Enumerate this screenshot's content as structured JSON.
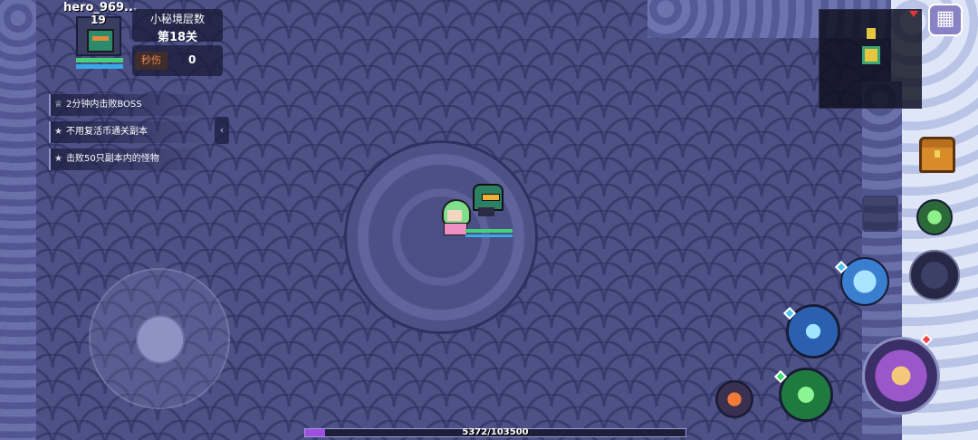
{
  "player": {
    "name": "hero_969...",
    "level": "19",
    "hp_fraction": 1.0,
    "mp_fraction": 1.0
  },
  "dungeon": {
    "floor_label": "小秘境层数",
    "floor_value": "第18关"
  },
  "dps": {
    "label": "秒伤",
    "value": "0"
  },
  "quests": [
    {
      "text": "2分钟内击败BOSS",
      "icon": "crown-icon"
    },
    {
      "text": "不用复活币通关副本",
      "icon": "star-icon"
    },
    {
      "text": "击败50只副本内的怪物",
      "icon": "star-icon"
    }
  ],
  "quest_toggle_icon": "‹",
  "menu_icon": "▦",
  "experience": {
    "text": "5372/103500",
    "fraction": 0.052
  },
  "colors": {
    "hp": "#46d17a",
    "mp": "#3aa7e8",
    "xp": "#9f4ee0",
    "dps_label": "#e9874a"
  }
}
